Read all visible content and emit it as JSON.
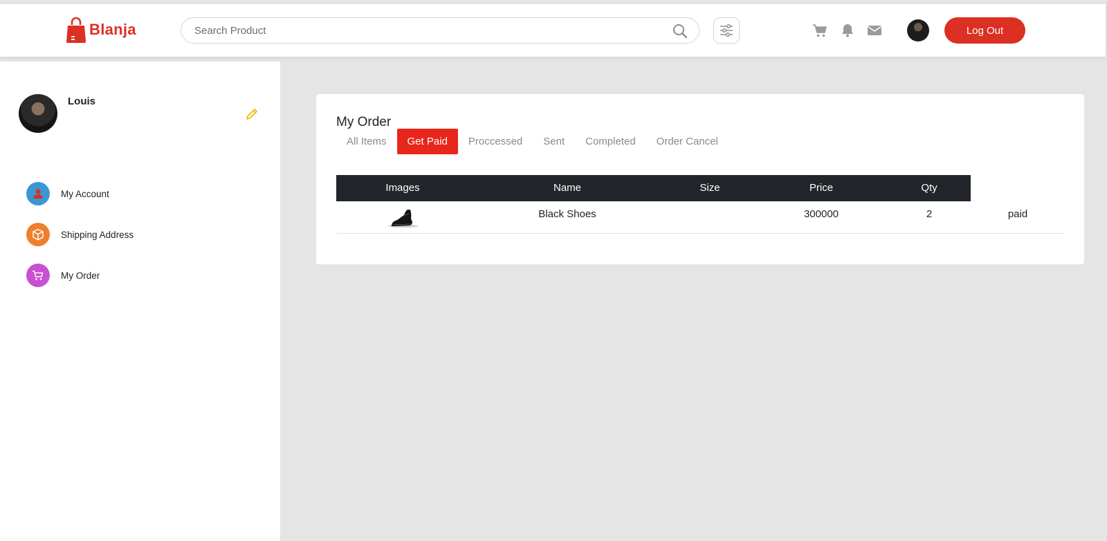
{
  "header": {
    "logo_text": "Blanja",
    "search_placeholder": "Search Product",
    "logout_label": "Log Out",
    "icons": [
      "search-icon",
      "filter-icon",
      "cart-icon",
      "bell-icon",
      "mail-icon"
    ]
  },
  "sidebar": {
    "user_name": "Louis",
    "items": [
      {
        "label": "My Account",
        "icon": "user-icon",
        "color": "#3b97d3"
      },
      {
        "label": "Shipping Address",
        "icon": "box-icon",
        "color": "#ef7f2e"
      },
      {
        "label": "My Order",
        "icon": "cart-icon",
        "color": "#c94fd3"
      }
    ]
  },
  "order": {
    "title": "My Order",
    "tabs": [
      "All Items",
      "Get Paid",
      "Proccessed",
      "Sent",
      "Completed",
      "Order Cancel"
    ],
    "active_tab": "Get Paid",
    "columns": [
      "Images",
      "Name",
      "Size",
      "Price",
      "Qty"
    ],
    "rows": [
      {
        "name": "Black Shoes",
        "size": "",
        "price": "300000",
        "qty": "2",
        "status": "paid"
      }
    ]
  },
  "colors": {
    "brand": "#db3022",
    "active_tab": "#e8261b",
    "table_header": "#22252a",
    "edit_icon": "#e6b800"
  }
}
